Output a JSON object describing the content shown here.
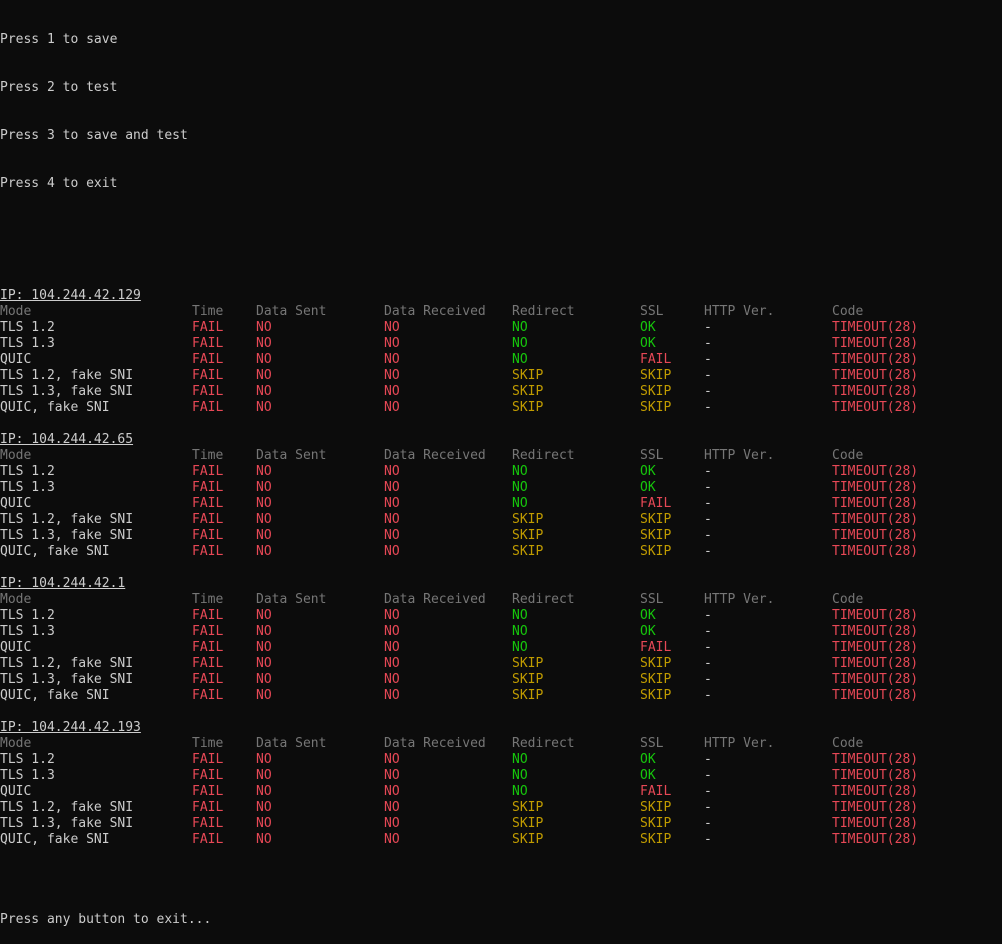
{
  "menu": [
    "Press 1 to save",
    "Press 2 to test",
    "Press 3 to save and test",
    "Press 4 to exit"
  ],
  "columns": [
    "Mode",
    "Time",
    "Data Sent",
    "Data Received",
    "Redirect",
    "SSL",
    "HTTP Ver.",
    "Code"
  ],
  "colors": {
    "background": "#0c0c0c",
    "text": "#cccccc",
    "header": "#767676",
    "fail": "#e74856",
    "ok": "#16c60c",
    "skip": "#c19c00"
  },
  "blocks": [
    {
      "ip": "IP: 104.244.42.129",
      "rows": [
        [
          "TLS 1.2",
          "FAIL",
          "NO",
          "NO",
          "NO",
          "OK",
          "-",
          "TIMEOUT(28)"
        ],
        [
          "TLS 1.3",
          "FAIL",
          "NO",
          "NO",
          "NO",
          "OK",
          "-",
          "TIMEOUT(28)"
        ],
        [
          "QUIC",
          "FAIL",
          "NO",
          "NO",
          "NO",
          "FAIL",
          "-",
          "TIMEOUT(28)"
        ],
        [
          "TLS 1.2, fake SNI",
          "FAIL",
          "NO",
          "NO",
          "SKIP",
          "SKIP",
          "-",
          "TIMEOUT(28)"
        ],
        [
          "TLS 1.3, fake SNI",
          "FAIL",
          "NO",
          "NO",
          "SKIP",
          "SKIP",
          "-",
          "TIMEOUT(28)"
        ],
        [
          "QUIC, fake SNI",
          "FAIL",
          "NO",
          "NO",
          "SKIP",
          "SKIP",
          "-",
          "TIMEOUT(28)"
        ]
      ]
    },
    {
      "ip": "IP: 104.244.42.65",
      "rows": [
        [
          "TLS 1.2",
          "FAIL",
          "NO",
          "NO",
          "NO",
          "OK",
          "-",
          "TIMEOUT(28)"
        ],
        [
          "TLS 1.3",
          "FAIL",
          "NO",
          "NO",
          "NO",
          "OK",
          "-",
          "TIMEOUT(28)"
        ],
        [
          "QUIC",
          "FAIL",
          "NO",
          "NO",
          "NO",
          "FAIL",
          "-",
          "TIMEOUT(28)"
        ],
        [
          "TLS 1.2, fake SNI",
          "FAIL",
          "NO",
          "NO",
          "SKIP",
          "SKIP",
          "-",
          "TIMEOUT(28)"
        ],
        [
          "TLS 1.3, fake SNI",
          "FAIL",
          "NO",
          "NO",
          "SKIP",
          "SKIP",
          "-",
          "TIMEOUT(28)"
        ],
        [
          "QUIC, fake SNI",
          "FAIL",
          "NO",
          "NO",
          "SKIP",
          "SKIP",
          "-",
          "TIMEOUT(28)"
        ]
      ]
    },
    {
      "ip": "IP: 104.244.42.1",
      "rows": [
        [
          "TLS 1.2",
          "FAIL",
          "NO",
          "NO",
          "NO",
          "OK",
          "-",
          "TIMEOUT(28)"
        ],
        [
          "TLS 1.3",
          "FAIL",
          "NO",
          "NO",
          "NO",
          "OK",
          "-",
          "TIMEOUT(28)"
        ],
        [
          "QUIC",
          "FAIL",
          "NO",
          "NO",
          "NO",
          "FAIL",
          "-",
          "TIMEOUT(28)"
        ],
        [
          "TLS 1.2, fake SNI",
          "FAIL",
          "NO",
          "NO",
          "SKIP",
          "SKIP",
          "-",
          "TIMEOUT(28)"
        ],
        [
          "TLS 1.3, fake SNI",
          "FAIL",
          "NO",
          "NO",
          "SKIP",
          "SKIP",
          "-",
          "TIMEOUT(28)"
        ],
        [
          "QUIC, fake SNI",
          "FAIL",
          "NO",
          "NO",
          "SKIP",
          "SKIP",
          "-",
          "TIMEOUT(28)"
        ]
      ]
    },
    {
      "ip": "IP: 104.244.42.193",
      "rows": [
        [
          "TLS 1.2",
          "FAIL",
          "NO",
          "NO",
          "NO",
          "OK",
          "-",
          "TIMEOUT(28)"
        ],
        [
          "TLS 1.3",
          "FAIL",
          "NO",
          "NO",
          "NO",
          "OK",
          "-",
          "TIMEOUT(28)"
        ],
        [
          "QUIC",
          "FAIL",
          "NO",
          "NO",
          "NO",
          "FAIL",
          "-",
          "TIMEOUT(28)"
        ],
        [
          "TLS 1.2, fake SNI",
          "FAIL",
          "NO",
          "NO",
          "SKIP",
          "SKIP",
          "-",
          "TIMEOUT(28)"
        ],
        [
          "TLS 1.3, fake SNI",
          "FAIL",
          "NO",
          "NO",
          "SKIP",
          "SKIP",
          "-",
          "TIMEOUT(28)"
        ],
        [
          "QUIC, fake SNI",
          "FAIL",
          "NO",
          "NO",
          "SKIP",
          "SKIP",
          "-",
          "TIMEOUT(28)"
        ]
      ]
    }
  ],
  "footer": "Press any button to exit..."
}
